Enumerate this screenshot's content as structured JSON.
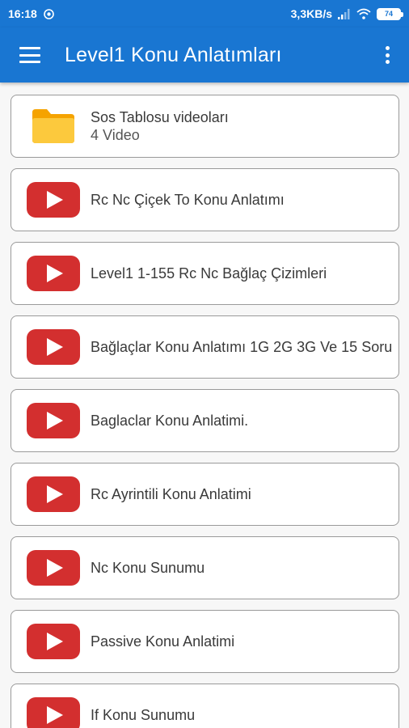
{
  "status_bar": {
    "time": "16:18",
    "network_speed": "3,3KB/s",
    "battery": "74"
  },
  "app_bar": {
    "title": "Level1 Konu Anlatımları"
  },
  "items": [
    {
      "type": "folder",
      "title": "Sos Tablosu videoları",
      "subtitle": "4 Video",
      "icon": "folder-icon"
    },
    {
      "type": "video",
      "title": "Rc Nc Çiçek To Konu Anlatımı",
      "icon": "youtube-play-icon"
    },
    {
      "type": "video",
      "title": "Level1 1-155 Rc Nc Bağlaç Çizimleri",
      "icon": "youtube-play-icon"
    },
    {
      "type": "video",
      "title": "Bağlaçlar Konu Anlatımı 1G 2G 3G Ve 15 Soru",
      "icon": "youtube-play-icon"
    },
    {
      "type": "video",
      "title": "Baglaclar Konu Anlatimi.",
      "icon": "youtube-play-icon"
    },
    {
      "type": "video",
      "title": "Rc Ayrintili Konu Anlatimi",
      "icon": "youtube-play-icon"
    },
    {
      "type": "video",
      "title": "Nc Konu Sunumu",
      "icon": "youtube-play-icon"
    },
    {
      "type": "video",
      "title": "Passive Konu Anlatimi",
      "icon": "youtube-play-icon"
    },
    {
      "type": "video",
      "title": "If Konu Sunumu",
      "icon": "youtube-play-icon"
    }
  ],
  "colors": {
    "primary": "#1976d2",
    "play_red": "#d32f2f",
    "folder_yellow": "#fbbf24"
  }
}
